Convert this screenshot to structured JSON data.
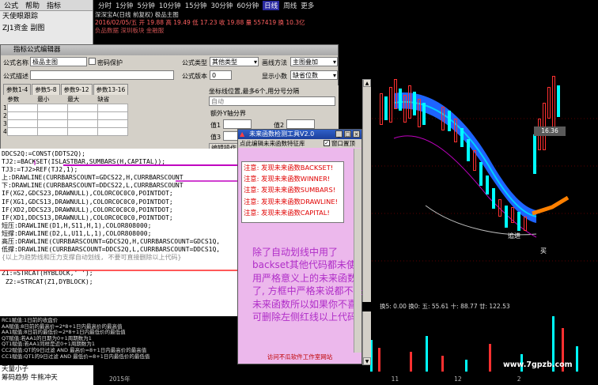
{
  "sidebar": {
    "toolbar": [
      "公式",
      "帮助",
      "指标"
    ],
    "items": [
      "天使眼跟踪",
      "ZJ1资金 副图"
    ]
  },
  "period_tabs": [
    "分时",
    "1分钟",
    "5分钟",
    "10分钟",
    "15分钟",
    "30分钟",
    "60分钟",
    "日线",
    "周线",
    "更多"
  ],
  "active_period": "日线",
  "stock_info": {
    "line1": "深深宝A(日线 前复权) 极品主图",
    "line2": "2016/02/05/五  开 19.88  高 19.49  低 17.23  收 19.88  量 557419  换 10.3亿",
    "line3": "负品数据 深圳板块 金融服"
  },
  "formula_editor": {
    "title": "指标公式编辑器",
    "name_label": "公式名称",
    "name_value": "极品主图",
    "password_label": "密码保护",
    "desc_label": "公式描述",
    "type_label": "公式类型",
    "type_value": "其他类型",
    "draw_label": "画线方法",
    "draw_value": "主图叠加",
    "version_label": "公式版本",
    "version_value": "0",
    "decimal_label": "显示小数",
    "decimal_value": "缺省位数",
    "param_tabs": [
      "参数1-4",
      "参数5-8",
      "参数9-12",
      "参数13-16"
    ],
    "param_headers": [
      "参数",
      "最小",
      "最大",
      "缺省"
    ],
    "row_numbers": [
      "1",
      "2",
      "3",
      "4"
    ],
    "coord_label": "坐标线位置,最多6个,用分号分隔",
    "coord_value": "自动",
    "yaxis_label": "额外Y轴分界",
    "val_labels": [
      "值1",
      "值2",
      "值3",
      "值4"
    ],
    "edit_button": "编辑操作"
  },
  "code_lines": [
    {
      "text": "DDCS2Q:=CONST(DDTS2Q);",
      "cls": ""
    },
    {
      "text": "TJ2:=BACKSET(ISLASTBAR,SUMBARS(H,CAPITAL));",
      "cls": ""
    },
    {
      "text": "TJ3:=TJ2>REF(TJ2,1);",
      "cls": ""
    },
    {
      "text": "上:DRAWLINE(CURRBARSCOUNT=GDCS22,H,CURRBARSCOUNT",
      "cls": ""
    },
    {
      "text": "下:DRAWLINE(CURRBARSCOUNT=DDCS22,L,CURRBARSCOUNT",
      "cls": ""
    },
    {
      "text": "IF(XG2,GDCS23,DRAWNULL),COLORC0C0C0,POINTDOT;",
      "cls": ""
    },
    {
      "text": "IF(XG1,GDCS13,DRAWNULL),COLORC0C0C0,POINTDOT;",
      "cls": ""
    },
    {
      "text": "IF(XD2,DDCS23,DRAWNULL),COLORC0C0C0,POINTDOT;",
      "cls": ""
    },
    {
      "text": "IF(XD1,DDCS13,DRAWNULL),COLORC0C0C0,POINTDOT;",
      "cls": ""
    },
    {
      "text": "短压:DRAWLINE(D1,H,S11,H,1),COLOR808000;",
      "cls": ""
    },
    {
      "text": "短撑:DRAWLINE(D2,L,U11,L,1),COLOR808000;",
      "cls": ""
    },
    {
      "text": "高压:DRAWLINE(CURRBARSCOUNT=GDCS2Q,H,CURRBARSCOUNT=GDCS1Q,",
      "cls": ""
    },
    {
      "text": "低撑:DRAWLINE(CURRBARSCOUNT=DDCS2Q,L,CURRBARSCOUNT=DDCS1Q,",
      "cls": ""
    },
    {
      "text": "{以上为趋势线和压力支撑自动划线, 不要可直接删除以上代码}",
      "cls": "gr"
    },
    {
      "text": "",
      "cls": ""
    },
    {
      "text": "Z1:=STRCAT(HYBLOCK,' ');",
      "cls": ""
    },
    {
      "text": " Z2:=STRCAT(Z1,DYBLOCK);",
      "cls": ""
    }
  ],
  "notes_lines": [
    "RC1赋值:1日前的收盘价",
    "AA赋值:8日前的最高价=2*8+1日内最高价的最高值",
    "AA1赋值:8日前的最低价=2*8+1日内最低价的最低值",
    "QT赋值:若AA1的日期为0+1周期数为1",
    "QT1赋值:若AA1同样是近0+1周期数为1",
    "CC2赋值:QT的9日过滤 AND 最高价=8+1日内最高价的最高值",
    "CC1赋值:QT1的9日过滤 AND 最低价=8+1日内最低价的最低值"
  ],
  "bottom_panel": [
    "天量小子",
    "筹码趋势 牛熊冲天"
  ],
  "popup": {
    "title": "未来函数检测工具V2.0",
    "toolbar_text": "点此编辑未来函数特征库",
    "topmost_label": "窗口置顶",
    "warnings": [
      "注意: 发现未来函数BACKSET!",
      "注意: 发现未来函数WINNER!",
      "注意: 发现未来函数SUMBARS!",
      "注意: 发现未来函数DRAWLINE!",
      "注意: 发现未来函数CAPITAL!"
    ],
    "explanation": "除了自动划线中用了backset其他代码都未使用严格意义上的未来函数了, 方框中严格来说都不是未来函数所以如果你不喜, 可删除左侧红线以上代码",
    "footer": "访问不瓜软件工作室网站"
  },
  "chart_labels": {
    "price_tag": "16.36",
    "zhuijin": "追进",
    "mai": "买",
    "bottom_stats": "换5: 0.00 换0: 五: 55.61 十: 88.77 廿: 122.53",
    "dates": [
      "2015年",
      "11",
      "12",
      "2"
    ],
    "watermark": "www.7gpzb.com"
  },
  "colors": {
    "candle_up": "#ff3030",
    "candle_down": "#00ffff",
    "band_blue": "#1e64ff",
    "band_cyan": "#00d0ff",
    "band_orange": "#ff8000",
    "annotation_purple": "#b02ec8",
    "warning_red": "#e00000"
  }
}
